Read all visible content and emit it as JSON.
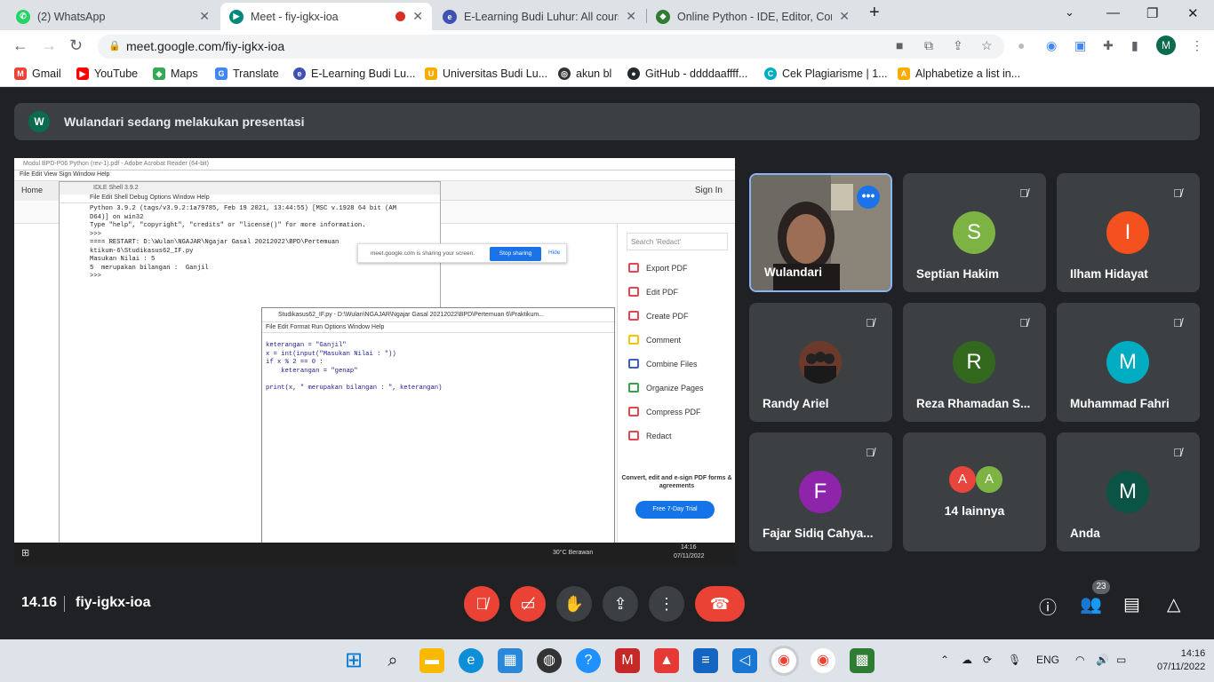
{
  "browser": {
    "tabs": [
      {
        "title": "(2) WhatsApp",
        "favicon": "whatsapp-icon",
        "color": "#25d366",
        "active": false
      },
      {
        "title": "Meet - fiy-igkx-ioa",
        "favicon": "meet-icon",
        "color": "#00897b",
        "active": true
      },
      {
        "title": "E-Learning Budi Luhur: All course",
        "favicon": "elearning-icon",
        "color": "#3f51b5",
        "active": false
      },
      {
        "title": "Online Python - IDE, Editor, Com",
        "favicon": "python-icon",
        "color": "#2e7d32",
        "active": false
      }
    ],
    "url": "meet.google.com/fiy-igkx-ioa",
    "profile_initial": "M",
    "bookmarks": [
      {
        "label": "Gmail",
        "color": "#ea4335"
      },
      {
        "label": "YouTube",
        "color": "#ff0000"
      },
      {
        "label": "Maps",
        "color": "#34a853"
      },
      {
        "label": "Translate",
        "color": "#4285f4"
      },
      {
        "label": "E-Learning Budi Lu...",
        "color": "#3f51b5"
      },
      {
        "label": "Universitas Budi Lu...",
        "color": "#f9ab00"
      },
      {
        "label": "akun bl",
        "color": "#333333"
      },
      {
        "label": "GitHub - ddddaaffff...",
        "color": "#24292e"
      },
      {
        "label": "Cek Plagiarisme | 1...",
        "color": "#00acc1"
      },
      {
        "label": "Alphabetize a list in...",
        "color": "#f9ab00"
      }
    ]
  },
  "meet": {
    "presenter_initial": "W",
    "presenting_text": "Wulandari sedang melakukan presentasi",
    "time": "14.16",
    "meeting_code": "fiy-igkx-ioa",
    "participant_count": "23",
    "participants": [
      {
        "name": "Wulandari",
        "initial": "",
        "color": "#5f6368",
        "video": true
      },
      {
        "name": "Septian Hakim",
        "initial": "S",
        "color": "#7cb342"
      },
      {
        "name": "Ilham Hidayat",
        "initial": "I",
        "color": "#f4511e"
      },
      {
        "name": "Randy Ariel",
        "initial": "",
        "color": "#5d4037"
      },
      {
        "name": "Reza Rhamadan S...",
        "initial": "R",
        "color": "#33691e"
      },
      {
        "name": "Muhammad Fahri",
        "initial": "M",
        "color": "#00acc1"
      },
      {
        "name": "Fajar Sidiq Cahya...",
        "initial": "F",
        "color": "#8e24aa"
      },
      {
        "name": "14 lainnya",
        "initial": "",
        "color": "#3c4043"
      },
      {
        "name": "Anda",
        "initial": "M",
        "color": "#0b5345"
      }
    ],
    "others_avatars": [
      "A",
      "A"
    ]
  },
  "shared": {
    "acrobat_title": "Modul BPD-P06 Python (rev-1).pdf - Adobe Acrobat Reader (64-bit)",
    "acrobat_menu": "File  Edit  View  Sign  Window  Help",
    "home": "Home",
    "sign_in": "Sign In",
    "idle_title": "IDLE Shell 3.9.2",
    "idle_menu": "File  Edit  Shell  Debug  Options  Window  Help",
    "idle_text": "Python 3.9.2 (tags/v3.9.2:1a79785, Feb 19 2021, 13:44:55) [MSC v.1928 64 bit (AM\nD64)] on win32\nType \"help\", \"copyright\", \"credits\" or \"license()\" for more information.\n>>>\n==== RESTART: D:\\Wulan\\NGAJAR\\Ngajar Gasal 20212022\\BPD\\Pertemuan\nktikum-6\\Studikasus62_IF.py\nMasukan Nilai : 5\n5  merupakan bilangan :  Ganjil\n>>>",
    "share_text": "meet.google.com is sharing your screen.",
    "stop_sharing": "Stop sharing",
    "hide": "Hide",
    "editor_title": "Studikasus62_IF.py - D:\\Wulan\\NGAJAR\\Ngajar Gasal 20212022\\BPD\\Pertemuan 6\\Praktikum...",
    "editor_menu": "File  Edit  Format  Run  Options  Window  Help",
    "editor_code": "keterangan = \"Ganjil\"\nx = int(input(\"Masukan Nilai : \"))\nif x % 2 == 0 :\n    keterangan = \"genap\"\n\nprint(x, \" merupakan bilangan : \", keterangan)",
    "search_placeholder": "Search 'Redact'",
    "tools": [
      "Export PDF",
      "Edit PDF",
      "Create PDF",
      "Comment",
      "Combine Files",
      "Organize Pages",
      "Compress PDF",
      "Redact"
    ],
    "promo": "Convert, edit and e-sign PDF forms & agreements",
    "trial": "Free 7-Day Trial",
    "weather": "30°C  Berawan",
    "inner_time": "14:16",
    "inner_date": "07/11/2022"
  },
  "taskbar": {
    "lang": "ENG",
    "time": "14:16",
    "date": "07/11/2022"
  }
}
